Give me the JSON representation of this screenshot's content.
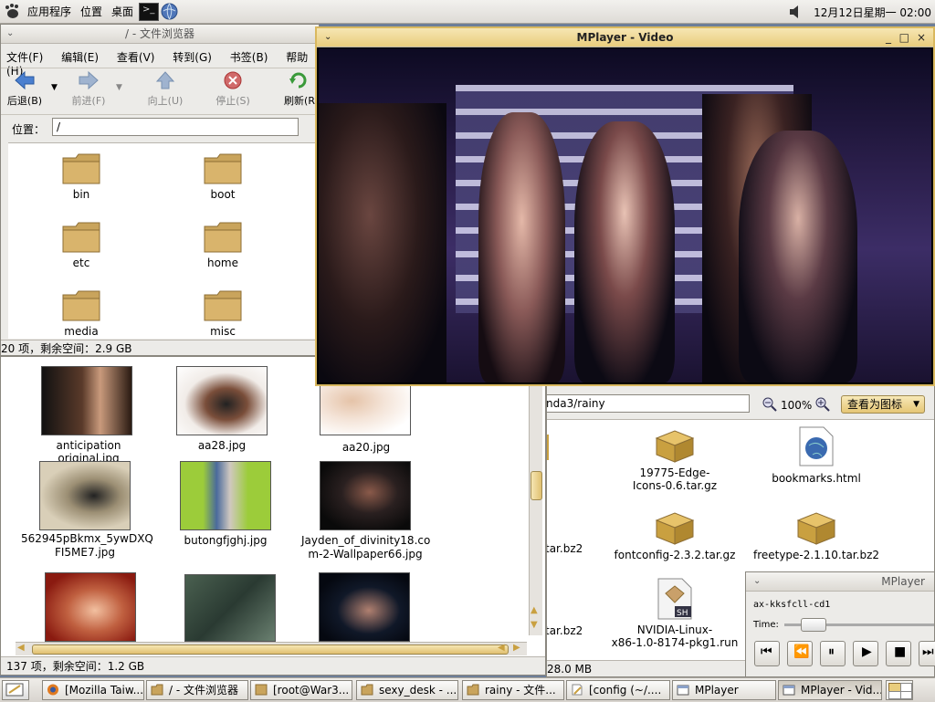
{
  "top_panel": {
    "menu_apps": "应用程序",
    "menu_places": "位置",
    "menu_desktop": "桌面",
    "clock": "12月12日星期一 02:00"
  },
  "file_browser": {
    "title": "/ - 文件浏览器",
    "menu": [
      "文件(F)",
      "编辑(E)",
      "查看(V)",
      "转到(G)",
      "书签(B)",
      "帮助(H)"
    ],
    "toolbar": {
      "back": "后退(B)",
      "forward": "前进(F)",
      "up": "向上(U)",
      "stop": "停止(S)",
      "reload": "刷新(R"
    },
    "location_label": "位置：",
    "location_value": "/",
    "folders": [
      "bin",
      "boot",
      "etc",
      "home",
      "media",
      "misc"
    ],
    "status": "20 项，剩余空间：2.9 GB"
  },
  "image_browser": {
    "files": [
      "anticipation original.jpg",
      "aa28.jpg",
      "aa20.jpg",
      "562945pBkmx_5ywDXQ",
      "FI5ME7.jpg",
      "butongfjghj.jpg",
      "Jayden_of_divinity18.co",
      "m-2-Wallpaper66.jpg"
    ],
    "status": "137 项，剩余空间：1.2 GB"
  },
  "rainy_browser": {
    "location_value": "nda3/rainy",
    "zoom": "100%",
    "view_as": "查看为图标",
    "files": {
      "edge_icons_1": "19775-Edge-",
      "edge_icons_2": "Icons-0.6.tar.gz",
      "bookmarks": "bookmarks.html",
      "bz2_a": "tar.bz2",
      "fontconfig": "fontconfig-2.3.2.tar.gz",
      "freetype": "freetype-2.1.10.tar.bz2",
      "bz2_b": "tar.bz2",
      "nvidia_1": "NVIDIA-Linux-",
      "nvidia_2": "x86-1.0-8174-pkg1.run"
    },
    "status": "28.0 MB"
  },
  "mplayer_video": {
    "title": "MPlayer - Video"
  },
  "mplayer_control": {
    "title": "MPlayer",
    "file": "ax-kksfcll-cd1",
    "time_label": "Time:"
  },
  "taskbar": {
    "items": [
      "[Mozilla Taiw...",
      "/ - 文件浏览器",
      "[root@War3...",
      "sexy_desk - ...",
      "rainy - 文件...",
      "[config (~/....",
      "MPlayer",
      "MPlayer - Vid..."
    ]
  },
  "colors": {
    "active_title": "#e9cd7d",
    "folder": "#c9a45c",
    "panel": "#dedbd6"
  }
}
